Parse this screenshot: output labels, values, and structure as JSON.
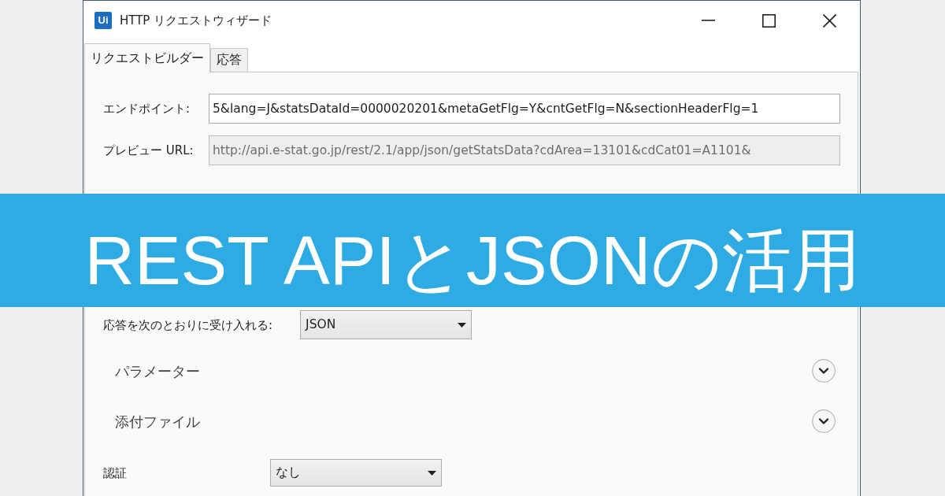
{
  "window": {
    "logo": "Ui",
    "title": "HTTP リクエストウィザード"
  },
  "tabs": [
    {
      "label": "リクエストビルダー",
      "selected": true
    },
    {
      "label": "応答",
      "selected": false
    }
  ],
  "fields": [
    {
      "kind": "url",
      "label": "エンドポイント:",
      "value": "5&lang=J&statsDataId=0000020201&metaGetFlg=Y&cntGetFlg=N&sectionHeaderFlg=1",
      "disabled": false
    },
    {
      "kind": "url",
      "label": "プレビュー URL:",
      "value": "http://api.e-stat.go.jp/rest/2.1/app/json/getStatsData?cdArea=13101&cdCat01=A1101&",
      "disabled": true
    },
    {
      "kind": "dropdown",
      "label": "応答を次のとおりに受け入れる:",
      "value": "JSON"
    },
    {
      "kind": "section",
      "label": "パラメーター",
      "expanded": false
    },
    {
      "kind": "section",
      "label": "添付ファイル",
      "expanded": false
    },
    {
      "kind": "dropdown",
      "label": "認証",
      "value": "なし"
    }
  ],
  "banner": {
    "title": "REST APIとJSONの活用"
  }
}
